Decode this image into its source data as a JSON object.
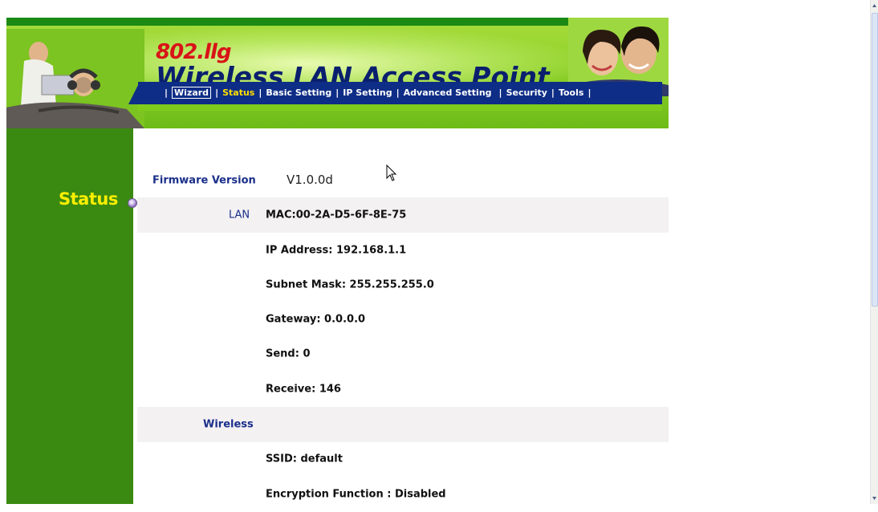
{
  "header": {
    "model": "802.llg",
    "title": "Wireless LAN Access Point"
  },
  "nav": {
    "items": [
      {
        "label": "Wizard"
      },
      {
        "label": "Status"
      },
      {
        "label": "Basic Setting"
      },
      {
        "label": "IP Setting"
      },
      {
        "label": "Advanced Setting"
      },
      {
        "label": "Security"
      },
      {
        "label": "Tools"
      }
    ],
    "active": "Status",
    "separator": "|"
  },
  "sidebar": {
    "section_label": "Status"
  },
  "status": {
    "firmware": {
      "label": "Firmware Version",
      "value": "V1.0.0d"
    },
    "lan": {
      "label": "LAN",
      "mac": "MAC:00-2A-D5-6F-8E-75",
      "ip": "IP Address: 192.168.1.1",
      "subnet": "Subnet Mask: 255.255.255.0",
      "gateway": "Gateway: 0.0.0.0",
      "send": "Send: 0",
      "receive": "Receive: 146"
    },
    "wireless": {
      "label": "Wireless",
      "ssid": "SSID: default",
      "encryption": "Encryption Function : Disabled"
    }
  },
  "colors": {
    "sidebar_green": "#3a8a12",
    "nav_blue": "#0e2d86",
    "label_blue": "#1a2f8a",
    "active_yellow": "#ffe000",
    "model_red": "#d81418"
  }
}
